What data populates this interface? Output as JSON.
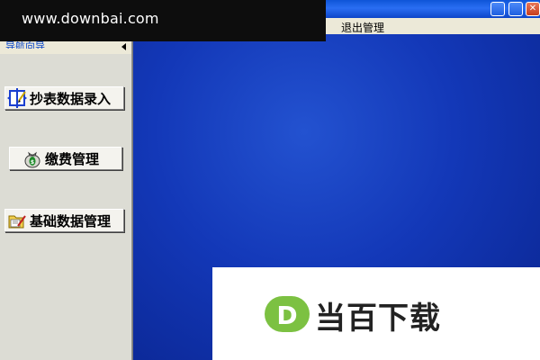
{
  "menubar": {
    "items": [
      {
        "label": "退出管理"
      }
    ]
  },
  "watermark": {
    "top_text": "www.downbai.com",
    "logo_text": "当百下载",
    "logo_letter": "D",
    "logo_color": "#7cc142"
  },
  "nav": {
    "title": "导航向导",
    "buttons": [
      {
        "label": "抄表数据录入",
        "icon": "meter-input-icon"
      },
      {
        "label": "缴费管理",
        "icon": "money-bag-icon"
      },
      {
        "label": "基础数据管理",
        "icon": "folder-edit-icon"
      }
    ]
  },
  "colors": {
    "title_bar": "#0f55d8",
    "main_background": "#1338b8",
    "nav_title": "#0a46c8"
  }
}
